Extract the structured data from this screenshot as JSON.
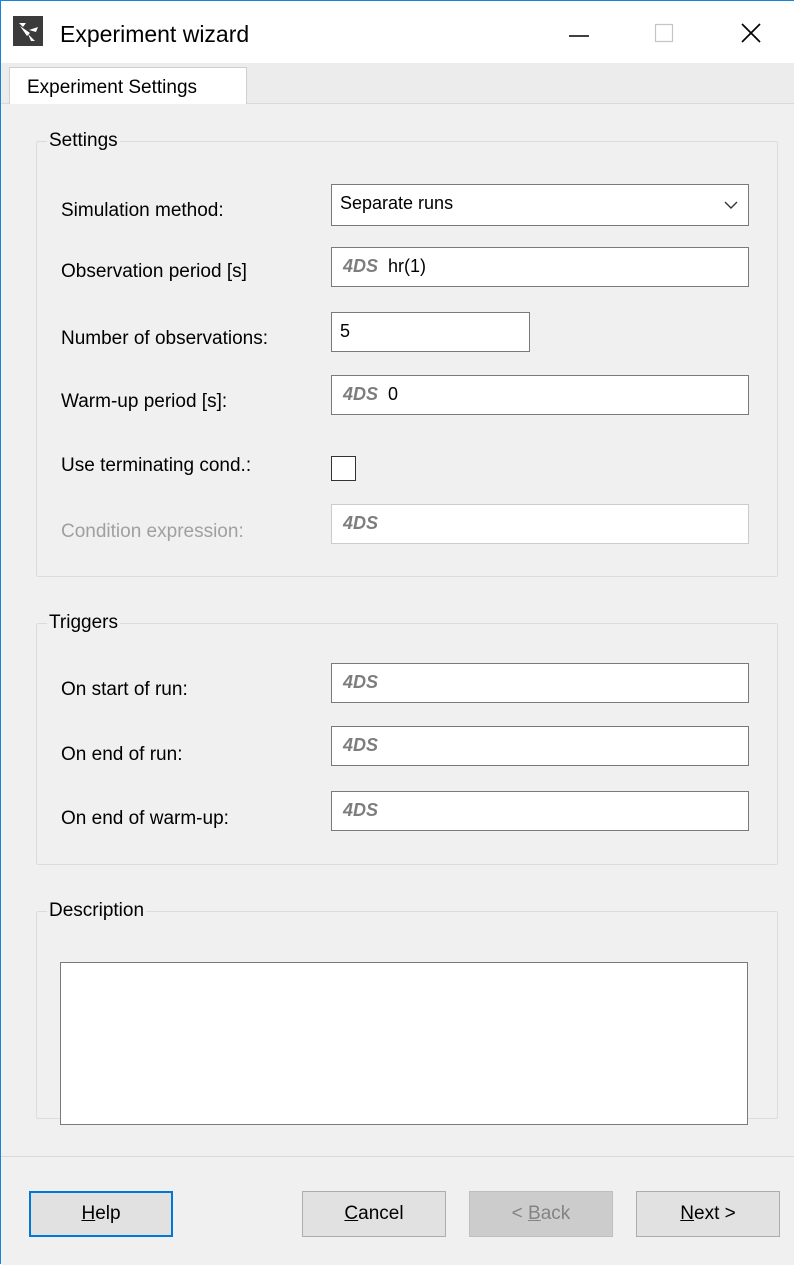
{
  "window": {
    "title": "Experiment wizard",
    "icons": {
      "app": "experiment-wizard-app-icon",
      "minimize": "minimize-icon",
      "maximize": "maximize-icon",
      "close": "close-icon"
    }
  },
  "tabs": [
    {
      "label": "Experiment Settings",
      "selected": true
    }
  ],
  "settings": {
    "group_label": "Settings",
    "simulation_method": {
      "label": "Simulation method:",
      "value": "Separate runs",
      "icon": "chevron-down-icon"
    },
    "observation_period": {
      "label": "Observation period [s]",
      "prefix": "4DS",
      "value": "hr(1)"
    },
    "number_of_observations": {
      "label": "Number of observations:",
      "value": "5"
    },
    "warmup_period": {
      "label": "Warm-up period [s]:",
      "prefix": "4DS",
      "value": "0"
    },
    "use_terminating_cond": {
      "label": "Use terminating cond.:",
      "checked": false
    },
    "condition_expression": {
      "label": "Condition expression:",
      "prefix": "4DS",
      "value": "",
      "disabled": true
    }
  },
  "triggers": {
    "group_label": "Triggers",
    "on_start_of_run": {
      "label": "On start of run:",
      "prefix": "4DS",
      "value": ""
    },
    "on_end_of_run": {
      "label": "On end of run:",
      "prefix": "4DS",
      "value": ""
    },
    "on_end_of_warmup": {
      "label": "On end of warm-up:",
      "prefix": "4DS",
      "value": ""
    }
  },
  "description": {
    "group_label": "Description",
    "value": ""
  },
  "footer": {
    "help": {
      "mnemonic": "H",
      "rest": "elp"
    },
    "cancel": {
      "mnemonic": "C",
      "rest": "ancel"
    },
    "back": {
      "pre": "< ",
      "mnemonic": "B",
      "rest": "ack",
      "disabled": true
    },
    "next": {
      "mnemonic": "N",
      "rest": "ext >"
    }
  },
  "colors": {
    "accent": "#0078d7",
    "window_border": "#1883d7",
    "panel_bg": "#f0f0f0",
    "disabled_text": "#a0a0a0"
  }
}
